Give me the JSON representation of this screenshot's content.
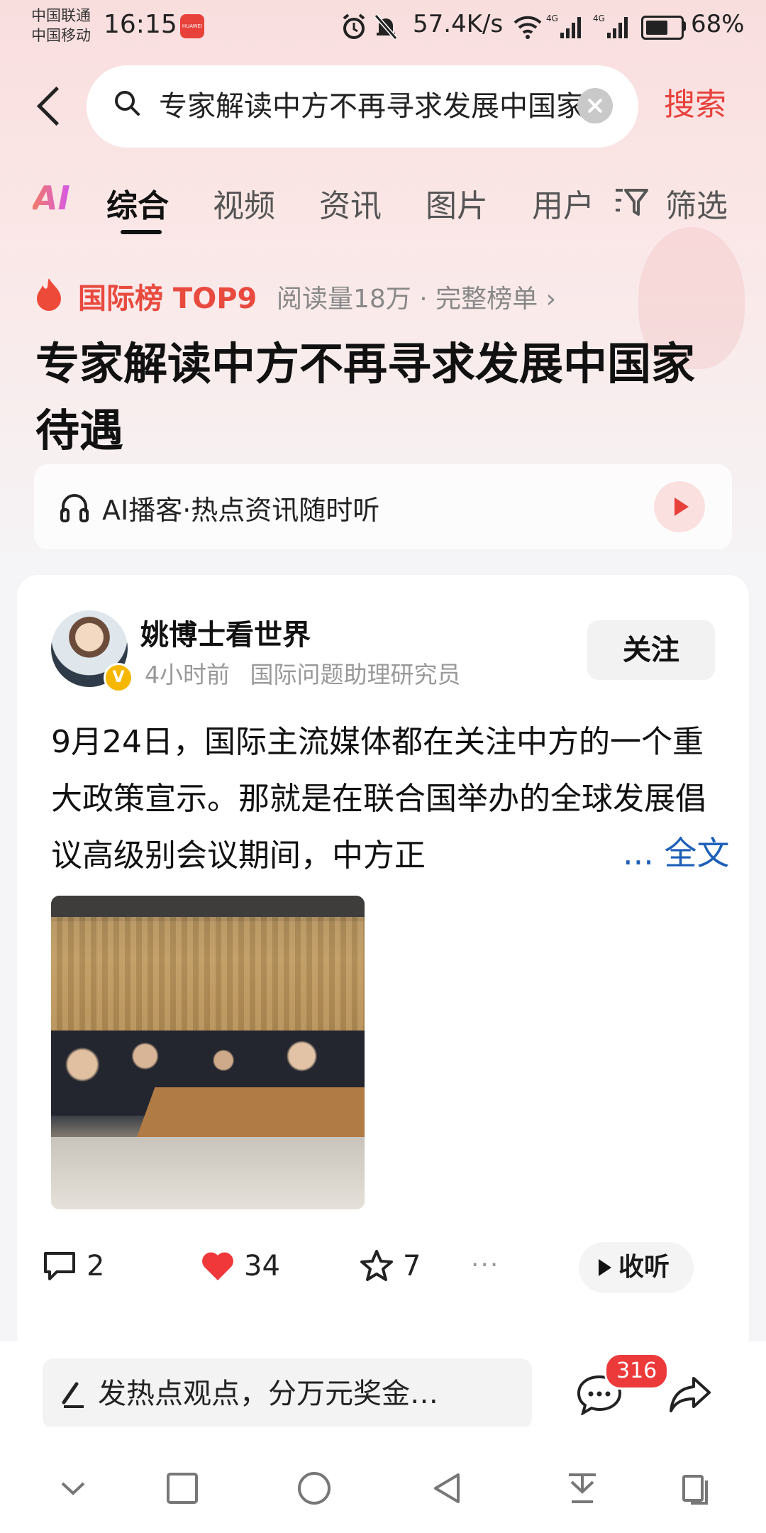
{
  "status_bar": {
    "carrier_1": "中国联通",
    "carrier_2": "中国移动",
    "time": "16:15",
    "net_speed": "57.4K/s",
    "battery": "68%",
    "app_badge": "HUAWEI"
  },
  "search": {
    "query": "专家解读中方不再寻求发展中国家待遇",
    "submit_label": "搜索"
  },
  "tabs": {
    "ai": "AI",
    "items": [
      "综合",
      "视频",
      "资讯",
      "图片",
      "用户"
    ],
    "active": "综合",
    "filter": "筛选"
  },
  "hot_rank": {
    "label": "国际榜 TOP9",
    "meta": "阅读量18万 · 完整榜单 ›",
    "headline": "专家解读中方不再寻求发展中国家待遇"
  },
  "podcast": {
    "label": "AI播客·热点资讯随时听"
  },
  "post": {
    "author": "姚博士看世界",
    "time": "4小时前",
    "role": "国际问题助理研究员",
    "follow": "关注",
    "verified_mark": "V",
    "text": "9月24日，国际主流媒体都在关注中方的一个重大政策宣示。那就是在联合国举办的全球发展倡议高级别会议期间，中方正",
    "full_text_link": "... 全文",
    "comments": "2",
    "likes": "34",
    "stars": "7",
    "more": "···",
    "listen": "收听"
  },
  "bottom": {
    "composer_placeholder": "发热点观点，分万元奖金…",
    "comment_count": "316"
  },
  "colors": {
    "accent": "#e6413d",
    "link": "#1d5fb8",
    "like": "#f0383b"
  }
}
